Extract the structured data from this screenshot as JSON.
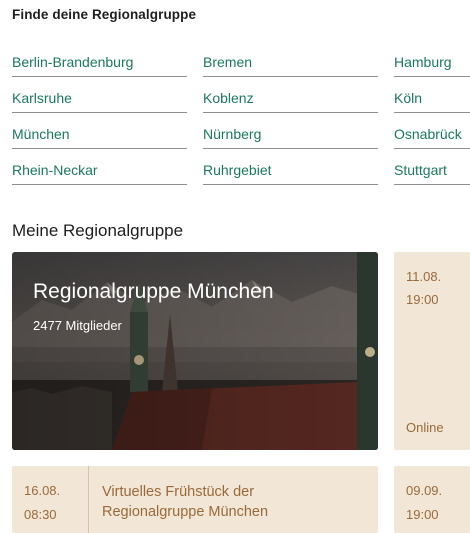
{
  "finder": {
    "title": "Finde deine Regionalgruppe",
    "regions": [
      "Berlin-Brandenburg",
      "Bremen",
      "Hamburg",
      "Karlsruhe",
      "Koblenz",
      "Köln",
      "München",
      "Nürnberg",
      "Osnabrück",
      "Rhein-Neckar",
      "Ruhrgebiet",
      "Stuttgart"
    ]
  },
  "my_group": {
    "heading": "Meine Regionalgruppe",
    "name": "Regionalgruppe München",
    "members": "2477 Mitglieder"
  },
  "events": [
    {
      "date": "11.08.",
      "time": "19:00",
      "location": "Online"
    },
    {
      "date": "16.08.",
      "time": "08:30",
      "title": "Virtuelles Frühstück der Regionalgruppe München"
    },
    {
      "date": "09.09.",
      "time": "19:00"
    }
  ],
  "colors": {
    "link": "#1a7a5e",
    "event_bg": "#f2e6d6",
    "event_text": "#9a6a3a"
  }
}
